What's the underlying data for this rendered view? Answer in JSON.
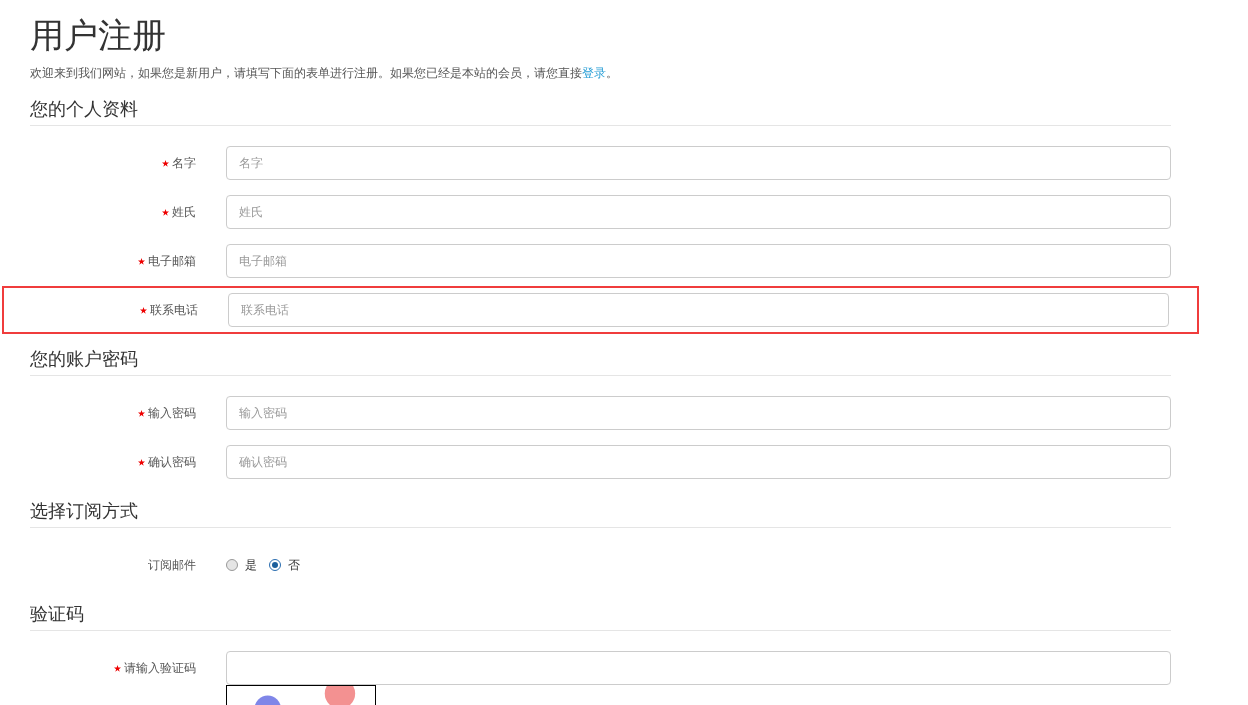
{
  "title": "用户注册",
  "intro": {
    "text": "欢迎来到我们网站，如果您是新用户，请填写下面的表单进行注册。如果您已经是本站的会员，请您直接",
    "link": "登录",
    "end": "。"
  },
  "sections": [
    {
      "heading": "您的个人资料",
      "rows": [
        {
          "kind": "text",
          "label": "名字",
          "required": true,
          "placeholder": "名字",
          "highlighted": false
        },
        {
          "kind": "text",
          "label": "姓氏",
          "required": true,
          "placeholder": "姓氏",
          "highlighted": false
        },
        {
          "kind": "text",
          "label": "电子邮箱",
          "required": true,
          "placeholder": "电子邮箱",
          "highlighted": false
        },
        {
          "kind": "text",
          "label": "联系电话",
          "required": true,
          "placeholder": "联系电话",
          "highlighted": true
        }
      ]
    },
    {
      "heading": "您的账户密码",
      "rows": [
        {
          "kind": "text",
          "label": "输入密码",
          "required": true,
          "placeholder": "输入密码",
          "highlighted": false
        },
        {
          "kind": "text",
          "label": "确认密码",
          "required": true,
          "placeholder": "确认密码",
          "highlighted": false
        }
      ]
    },
    {
      "heading": "选择订阅方式",
      "rows": [
        {
          "kind": "radio",
          "label": "订阅邮件",
          "required": false,
          "highlighted": false,
          "options": [
            {
              "label": "是",
              "selected": false
            },
            {
              "label": "否",
              "selected": true
            }
          ]
        }
      ]
    },
    {
      "heading": "验证码",
      "rows": [
        {
          "kind": "captcha",
          "label": "请输入验证码",
          "required": true,
          "highlighted": false
        }
      ]
    }
  ]
}
